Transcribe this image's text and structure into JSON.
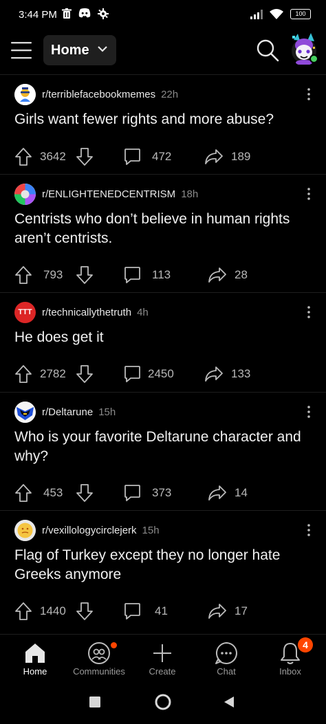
{
  "status_bar": {
    "time": "3:44 PM",
    "battery": "100"
  },
  "header": {
    "feed_selector": "Home"
  },
  "posts": [
    {
      "subreddit": "r/terriblefacebookmemes",
      "age": "22h",
      "title": "Girls want fewer rights and more abuse?",
      "votes": "3642",
      "comments": "472",
      "shares": "189"
    },
    {
      "subreddit": "r/ENLIGHTENEDCENTRISM",
      "age": "18h",
      "title": "Centrists who don’t believe in human rights aren’t centrists.",
      "votes": "793",
      "comments": "113",
      "shares": "28"
    },
    {
      "subreddit": "r/technicallythetruth",
      "age": "4h",
      "title": "He does get it",
      "votes": "2782",
      "comments": "2450",
      "shares": "133"
    },
    {
      "subreddit": "r/Deltarune",
      "age": "15h",
      "title": "Who is your favorite Deltarune character and why?",
      "votes": "453",
      "comments": "373",
      "shares": "14"
    },
    {
      "subreddit": "r/vexillologycirclejerk",
      "age": "15h",
      "title": "Flag of Turkey except they no longer hate Greeks anymore",
      "votes": "1440",
      "comments": "41",
      "shares": "17"
    }
  ],
  "technicallythetruth_icon_text": "TTT",
  "bottom_nav": {
    "home": "Home",
    "communities": "Communities",
    "create": "Create",
    "chat": "Chat",
    "inbox": "Inbox",
    "inbox_badge": "4"
  },
  "colors": {
    "background": "#000000",
    "accent": "#ff4500",
    "online": "#46d160"
  }
}
